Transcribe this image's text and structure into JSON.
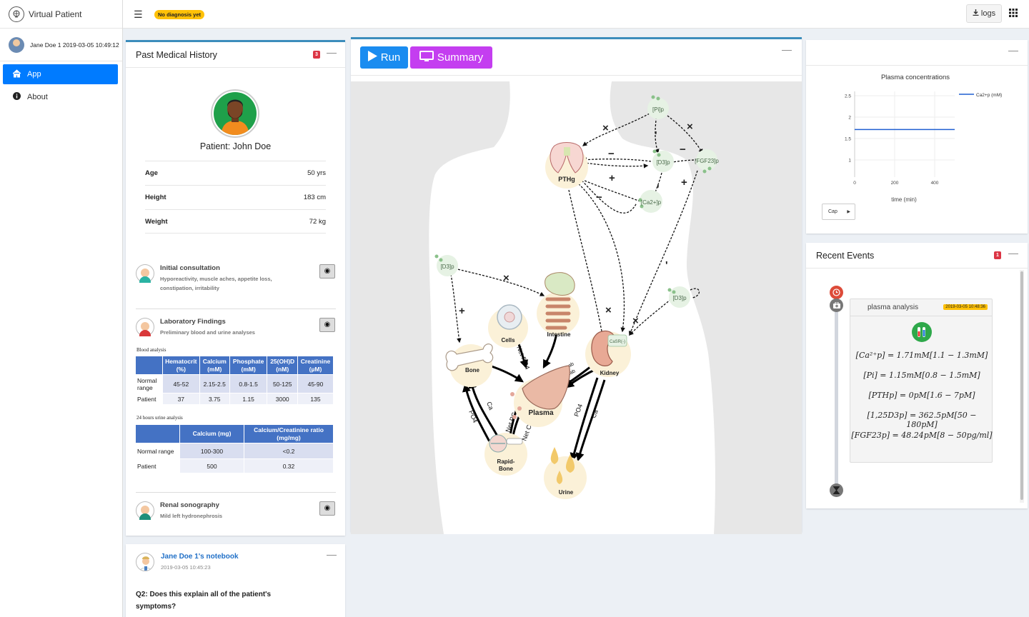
{
  "app": {
    "title": "Virtual Patient",
    "user_line": "Jane Doe 1 2019-03-05 10:49:12",
    "nav": [
      {
        "label": "App",
        "icon": "home-icon",
        "active": true
      },
      {
        "label": "About",
        "icon": "info-icon",
        "active": false
      }
    ]
  },
  "header": {
    "diagnosis_badge": "No diagnosis yet",
    "logs_label": "logs"
  },
  "pmh": {
    "title": "Past Medical History",
    "count": "3",
    "patient_name": "Patient: John Doe",
    "vitals": [
      {
        "label": "Age",
        "value": "50 yrs"
      },
      {
        "label": "Height",
        "value": "183 cm"
      },
      {
        "label": "Weight",
        "value": "72 kg"
      }
    ],
    "consultation": {
      "title": "Initial consultation",
      "subtitle": "Hyporeactivity, muscle aches, appetite loss, constipation, irritability"
    },
    "lab": {
      "title": "Laboratory Findings",
      "subtitle": "Preliminary blood and urine analyses",
      "blood_caption": "Blood analysis",
      "blood_headers": [
        "Hematocrit (%)",
        "Calcium (mM)",
        "Phosphate (mM)",
        "25(OH)D (nM)",
        "Creatinine (µM)"
      ],
      "blood_rows": [
        {
          "label": "Normal range",
          "values": [
            "45-52",
            "2.15-2.5",
            "0.8-1.5",
            "50-125",
            "45-90"
          ]
        },
        {
          "label": "Patient",
          "values": [
            "37",
            "3.75",
            "1.15",
            "3000",
            "135"
          ]
        }
      ],
      "urine_caption": "24 hours urine analysis",
      "urine_headers": [
        "Calcium (mg)",
        "Calcium/Creatinine ratio (mg/mg)"
      ],
      "urine_rows": [
        {
          "label": "Normal range",
          "values": [
            "100-300",
            "<0.2"
          ]
        },
        {
          "label": "Patient",
          "values": [
            "500",
            "0.32"
          ]
        }
      ]
    },
    "sonography": {
      "title": "Renal sonography",
      "subtitle": "Mild left hydronephrosis"
    }
  },
  "notebook": {
    "title": "Jane Doe 1's notebook",
    "date": "2019-03-05 10:45:23",
    "question": "Q2: Does this explain all of the patient's symptoms?"
  },
  "diagram": {
    "run_label": "Run",
    "summary_label": "Summary",
    "nodes": {
      "pi": "[Pi]p",
      "d3_top": "[D3]p",
      "fgf23": "[FGF23]p",
      "pthg": "PTHg",
      "ca2p": "[Ca2+]p",
      "d3_left": "[D3]p",
      "d3_right": "[D3]p",
      "intestine": "Intestine",
      "cells": "Cells",
      "bone": "Bone",
      "plasma": "Plasma",
      "kidney": "Kidney",
      "rapid_bone": [
        "Rapid-",
        "Bone"
      ],
      "urine": "Urine",
      "casr": "CaSR(-)"
    },
    "edge_labels": {
      "net_po4": "Net PO4",
      "po4_a": "PO4",
      "ca_a": "Ca",
      "net_pc": "Net PC",
      "net_c": "Net C",
      "po4_b": "PO4",
      "ca_b": "Ca",
      "reab_a": "Reab",
      "reab_b": "Reab"
    }
  },
  "plot": {
    "count": "",
    "select_value": "Cap",
    "chart_data": {
      "type": "line",
      "title": "Plasma concentrations",
      "xlabel": "time (min)",
      "ylabel": "",
      "xlim": [
        0,
        500
      ],
      "ylim": [
        0.6,
        2.6
      ],
      "xticks": [
        0,
        200,
        400
      ],
      "yticks": [
        1,
        1.5,
        2,
        2.5
      ],
      "grid": true,
      "legend": "top-right",
      "series": [
        {
          "name": "Ca2+p (mM)",
          "color": "#1f5fd1",
          "x": [
            0,
            500
          ],
          "y": [
            1.71,
            1.71
          ]
        }
      ]
    }
  },
  "events": {
    "title": "Recent Events",
    "count": "1",
    "event": {
      "title": "plasma analysis",
      "time": "2019-03-05 10:48:36",
      "lines": [
        "[Ca²⁺p] = 1.71mM[1.1 − 1.3mM]",
        "[Pi] = 1.15mM[0.8 − 1.5mM]",
        "[PTHp] = 0pM[1.6 − 7pM]",
        "[1,25D3p] = 362.5pM[50 − 180pM]",
        "[FGF23p] = 48.24pM[8 − 50pg/ml]"
      ]
    }
  }
}
